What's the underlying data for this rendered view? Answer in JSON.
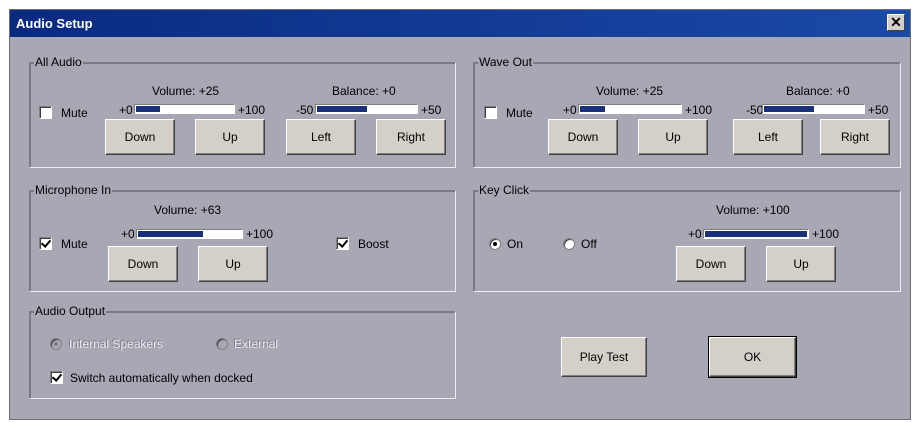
{
  "window": {
    "title": "Audio Setup",
    "close_icon": "close-icon"
  },
  "all_audio": {
    "title": "All Audio",
    "mute_label": "Mute",
    "mute_checked": false,
    "volume_label": "Volume: +25",
    "vol_min": "+0",
    "vol_max": "+100",
    "volume_fraction": 0.25,
    "balance_label": "Balance: +0",
    "bal_min": "-50",
    "bal_max": "+50",
    "balance_fraction": 0.5,
    "down": "Down",
    "up": "Up",
    "left": "Left",
    "right": "Right"
  },
  "wave_out": {
    "title": "Wave Out",
    "mute_label": "Mute",
    "mute_checked": false,
    "volume_label": "Volume: +25",
    "vol_min": "+0",
    "vol_max": "+100",
    "volume_fraction": 0.25,
    "balance_label": "Balance: +0",
    "bal_min": "-50",
    "bal_max": "+50",
    "balance_fraction": 0.5,
    "down": "Down",
    "up": "Up",
    "left": "Left",
    "right": "Right"
  },
  "microphone_in": {
    "title": "Microphone In",
    "mute_label": "Mute",
    "mute_checked": true,
    "volume_label": "Volume: +63",
    "vol_min": "+0",
    "vol_max": "+100",
    "volume_fraction": 0.63,
    "boost_label": "Boost",
    "boost_checked": true,
    "down": "Down",
    "up": "Up"
  },
  "key_click": {
    "title": "Key Click",
    "on_label": "On",
    "off_label": "Off",
    "selected": "on",
    "volume_label": "Volume: +100",
    "vol_min": "+0",
    "vol_max": "+100",
    "volume_fraction": 1.0,
    "down": "Down",
    "up": "Up"
  },
  "audio_output": {
    "title": "Audio Output",
    "internal_label": "Internal Speakers",
    "external_label": "External",
    "selected": "internal",
    "enabled": false,
    "switch_label": "Switch automatically when docked",
    "switch_checked": true
  },
  "actions": {
    "play_test": "Play Test",
    "ok": "OK"
  },
  "colors": {
    "titlebar": "#0a2a80",
    "dialog_bg": "#a8a8b4",
    "level_fill": "#1a2f7a"
  }
}
